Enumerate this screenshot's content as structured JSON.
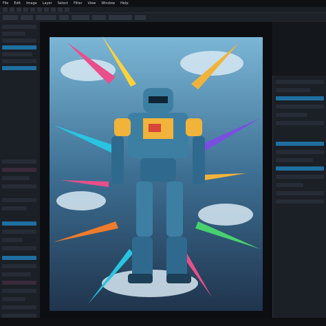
{
  "menu": {
    "items": [
      "File",
      "Edit",
      "Image",
      "Layer",
      "Select",
      "Filter",
      "View",
      "Window",
      "Help"
    ]
  },
  "colors": {
    "bg": "#14171c",
    "panel": "#1b1f26",
    "selection": "#1f6fa1",
    "sky": "#6aa6c8",
    "mech_main": "#3d7fa3",
    "mech_accent": "#f2b33a"
  }
}
